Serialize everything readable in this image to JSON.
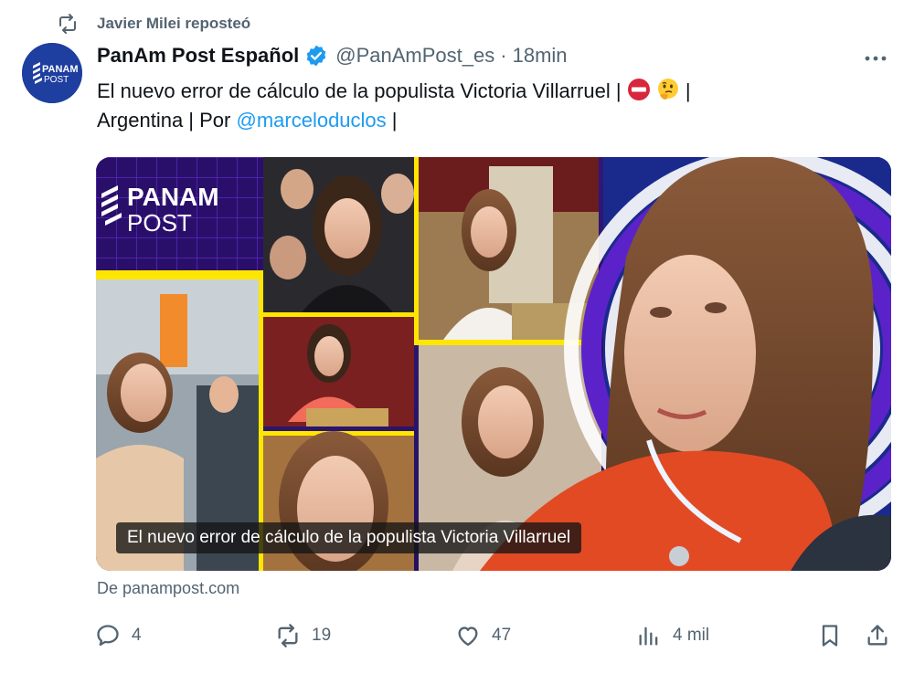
{
  "repost": {
    "label": "Javier Milei reposteó"
  },
  "author": {
    "name": "PanAm Post Español",
    "handle": "@PanAmPost_es",
    "separator": "·",
    "time": "18min",
    "avatar_text": "PANAM POST"
  },
  "tweet": {
    "text_part1": "El nuevo error de cálculo de la populista Victoria Villarruel |",
    "emoji1": "no-entry-icon",
    "emoji2": "thinking-face-icon",
    "text_part2": "|",
    "text_part3": "Argentina | Por",
    "mention": "@marceloduclos",
    "text_part4": "|"
  },
  "card": {
    "caption": "El nuevo error de cálculo de la populista Victoria Villarruel",
    "logo_main": "PANAM",
    "logo_sub": "POST",
    "source": "De panampost.com"
  },
  "actions": {
    "reply_count": "4",
    "repost_count": "19",
    "like_count": "47",
    "views_count": "4 mil"
  },
  "colors": {
    "accent": "#1d9bf0",
    "muted": "#536471",
    "card_bg": "#2a1264",
    "highlight": "#ffe600"
  }
}
